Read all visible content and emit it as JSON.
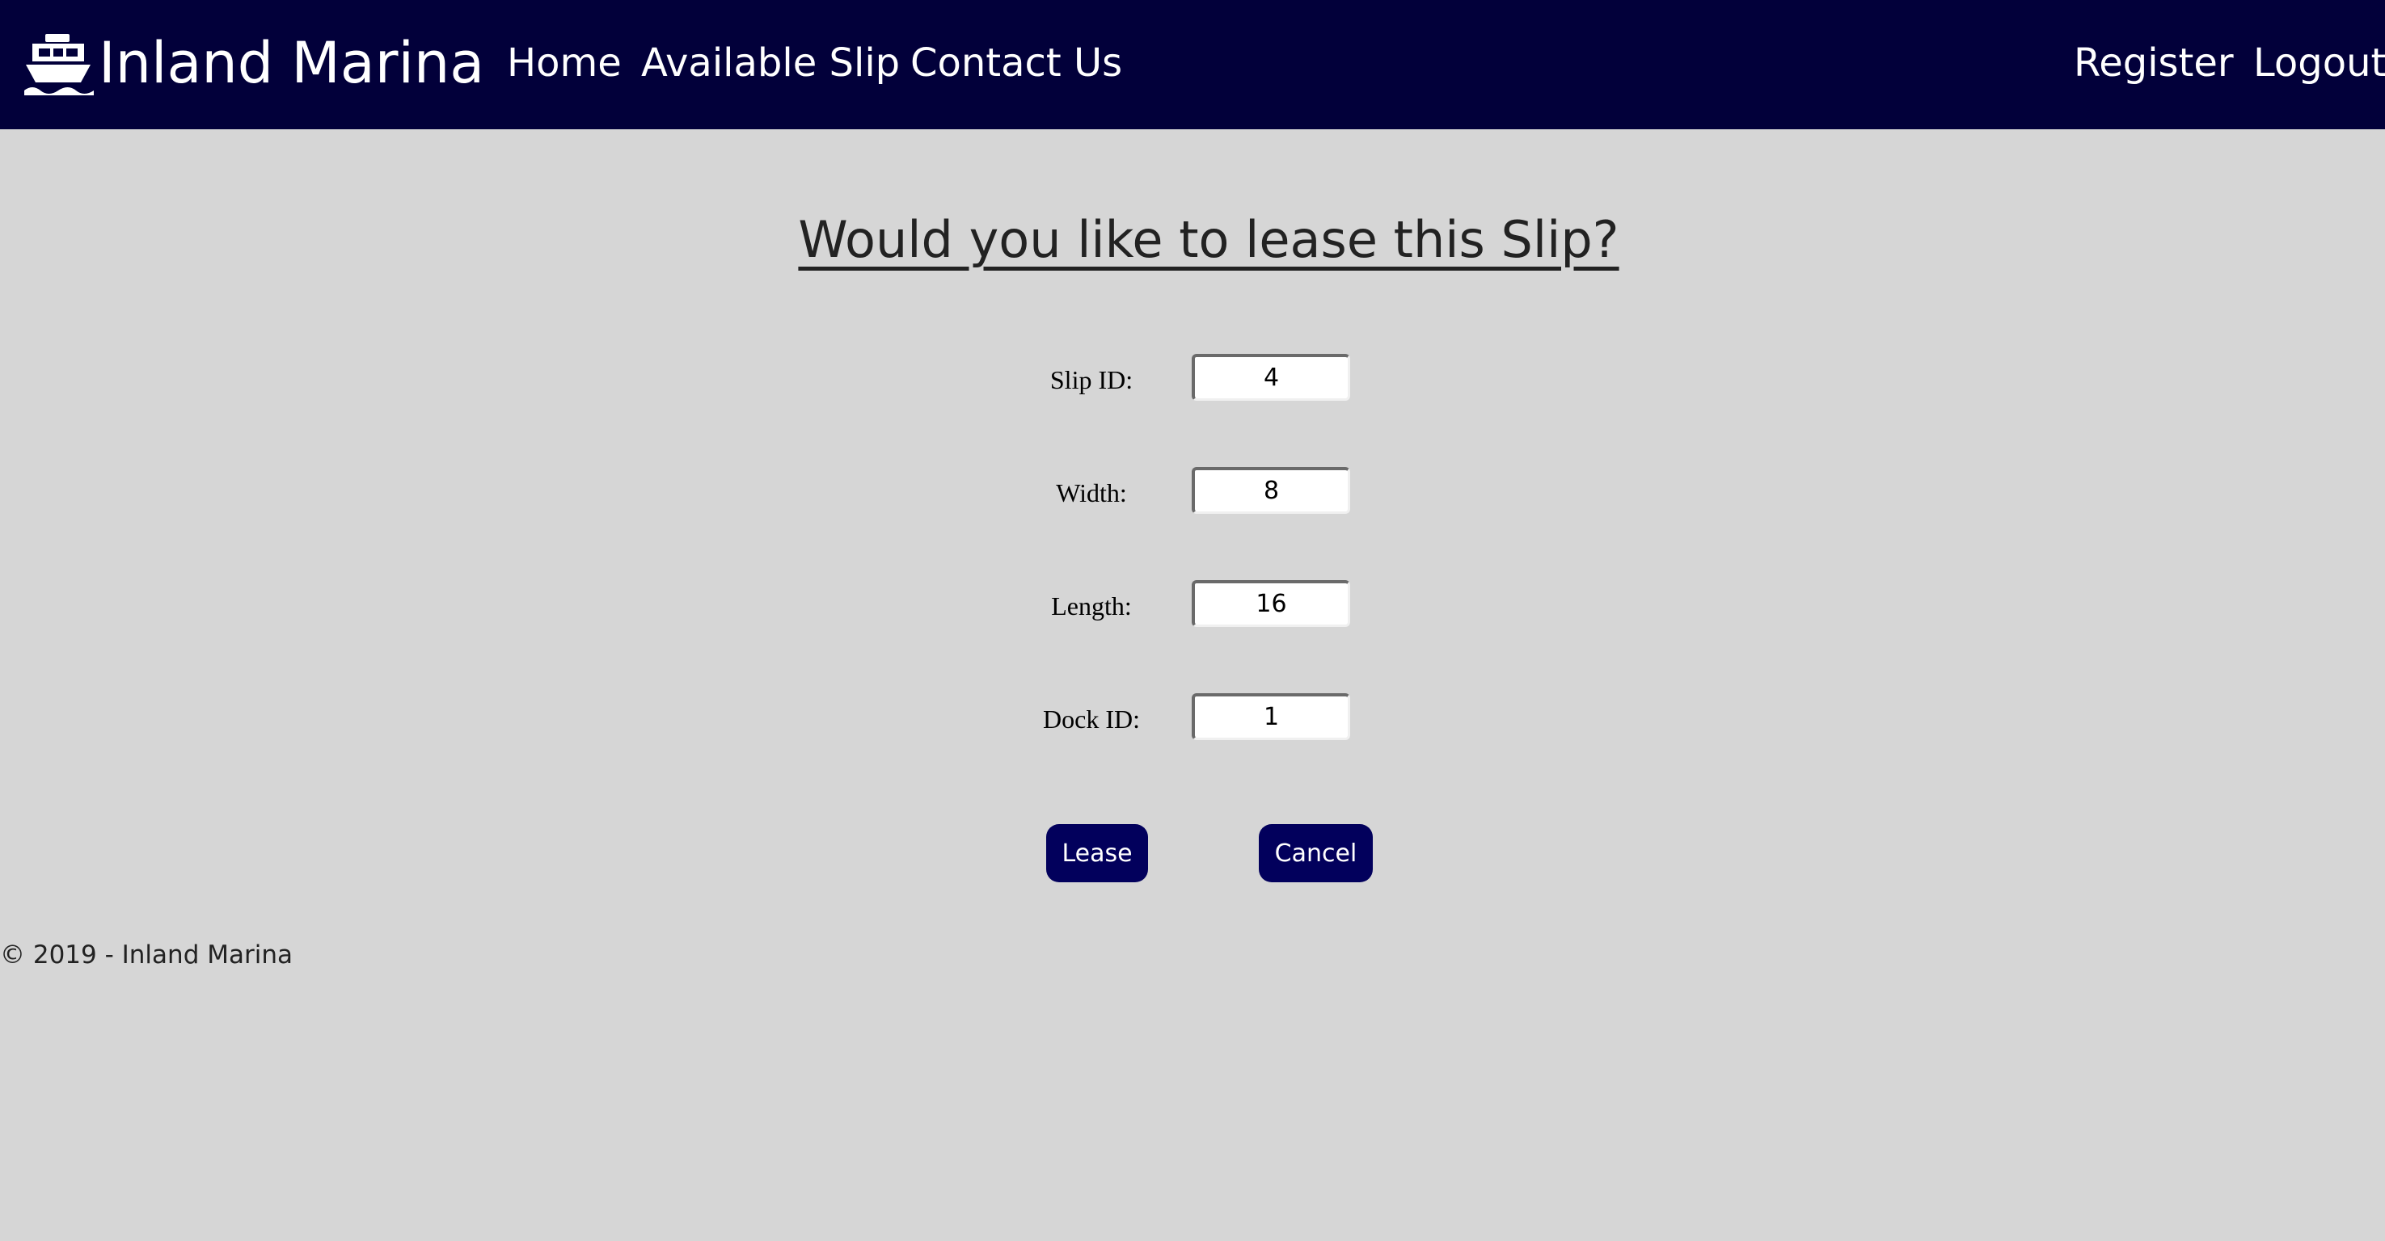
{
  "nav": {
    "brand": "Inland Marina",
    "brand_icon": "ship-icon",
    "links": {
      "home": "Home",
      "available_slip": "Available Slip",
      "contact_us": "Contact Us",
      "register": "Register",
      "logout": "Logout"
    }
  },
  "main": {
    "title": "Would you like to lease this Slip?",
    "fields": {
      "slip_id": {
        "label": "Slip ID:",
        "value": "4"
      },
      "width": {
        "label": "Width:",
        "value": "8"
      },
      "length": {
        "label": "Length:",
        "value": "16"
      },
      "dock_id": {
        "label": "Dock ID:",
        "value": "1"
      }
    },
    "buttons": {
      "lease": "Lease",
      "cancel": "Cancel"
    }
  },
  "footer": {
    "text": "© 2019 - Inland Marina"
  },
  "colors": {
    "navbar": "#02003a",
    "background": "#d6d6d6",
    "button": "#02005c"
  }
}
